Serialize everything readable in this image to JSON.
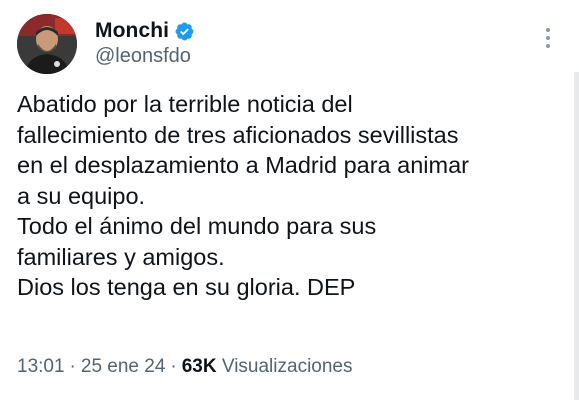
{
  "tweet": {
    "author": {
      "display_name": "Monchi",
      "handle": "@leonsfdo",
      "verified": true,
      "verified_color": "#1d9bf0",
      "avatar_icon": "profile-photo"
    },
    "more_icon": "ellipsis-vertical-icon",
    "text_lines": [
      "Abatido por la terrible noticia del",
      "fallecimiento de tres aficionados sevillistas",
      "en el desplazamiento a Madrid para animar",
      "a su equipo.",
      "Todo el ánimo del mundo para sus",
      "familiares y amigos.",
      "Dios los tenga en su gloria. DEP"
    ],
    "meta": {
      "time": "13:01",
      "separator": "·",
      "date": "25 ene 24",
      "views_count": "63K",
      "views_label": "Visualizaciones"
    }
  }
}
